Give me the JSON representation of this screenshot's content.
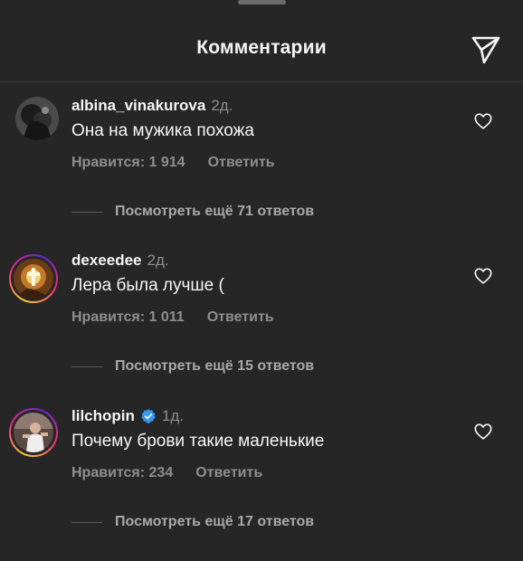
{
  "header": {
    "title": "Комментарии",
    "send_icon": "paper-plane-icon"
  },
  "comments": [
    {
      "username": "albina_vinakurova",
      "time": "2д.",
      "text": "Она на мужика похожа",
      "likes": "Нравится: 1 914",
      "reply": "Ответить",
      "view_replies": "Посмотреть ещё 71 ответов",
      "verified": false,
      "story_ring": false
    },
    {
      "username": "dexeedee",
      "time": "2д.",
      "text": "Лера была лучше (",
      "likes": "Нравится: 1 011",
      "reply": "Ответить",
      "view_replies": "Посмотреть ещё 15 ответов",
      "verified": false,
      "story_ring": true
    },
    {
      "username": "lilchopin",
      "time": "1д.",
      "text": "Почему брови такие маленькие",
      "likes": "Нравится: 234",
      "reply": "Ответить",
      "view_replies": "Посмотреть ещё 17 ответов",
      "verified": true,
      "story_ring": true
    }
  ],
  "colors": {
    "background": "#262626",
    "primary_text": "#f5f5f5",
    "secondary_text": "#8e8e8e",
    "verified_blue": "#3797f0"
  }
}
